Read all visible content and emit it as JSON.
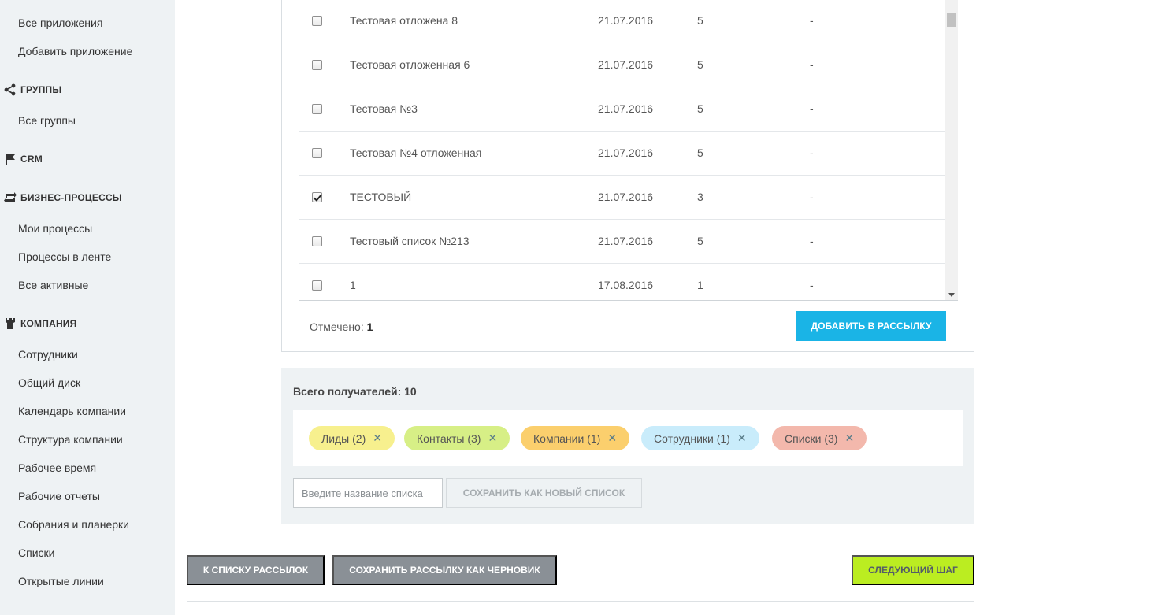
{
  "sidebar": {
    "links_top": [
      {
        "label": "Все приложения"
      },
      {
        "label": "Добавить приложение"
      }
    ],
    "sections": {
      "groups": {
        "title": "ГРУППЫ",
        "items": [
          "Все группы"
        ]
      },
      "crm": {
        "title": "CRM"
      },
      "bp": {
        "title": "БИЗНЕС-ПРОЦЕССЫ",
        "items": [
          "Мои процессы",
          "Процессы в ленте",
          "Все активные"
        ]
      },
      "company": {
        "title": "КОМПАНИЯ",
        "items": [
          "Сотрудники",
          "Общий диск",
          "Календарь компании",
          "Структура компании",
          "Рабочее время",
          "Рабочие отчеты",
          "Собрания и планерки",
          "Списки",
          "Открытые линии"
        ]
      }
    }
  },
  "table": {
    "rows": [
      {
        "name": "Тестовая отложена 8",
        "date": "21.07.2016",
        "count": "5",
        "extra": "-",
        "checked": false
      },
      {
        "name": "Тестовая отложенная 6",
        "date": "21.07.2016",
        "count": "5",
        "extra": "-",
        "checked": false
      },
      {
        "name": "Тестовая №3",
        "date": "21.07.2016",
        "count": "5",
        "extra": "-",
        "checked": false
      },
      {
        "name": "Тестовая №4 отложенная",
        "date": "21.07.2016",
        "count": "5",
        "extra": "-",
        "checked": false
      },
      {
        "name": "ТЕСТОВЫЙ",
        "date": "21.07.2016",
        "count": "3",
        "extra": "-",
        "checked": true
      },
      {
        "name": "Тестовый список №213",
        "date": "21.07.2016",
        "count": "5",
        "extra": "-",
        "checked": false
      },
      {
        "name": "1",
        "date": "17.08.2016",
        "count": "1",
        "extra": "-",
        "checked": false
      }
    ],
    "marked_label": "Отмечено:",
    "marked_count": "1",
    "add_button": "ДОБАВИТЬ В РАССЫЛКУ"
  },
  "recipients": {
    "title": "Всего получателей: 10",
    "tags": [
      {
        "label": "Лиды (2)",
        "color": "#f7f08e"
      },
      {
        "label": "Контакты (3)",
        "color": "#d7ef86"
      },
      {
        "label": "Компании (1)",
        "color": "#fbcf6d"
      },
      {
        "label": "Сотрудники (1)",
        "color": "#c9ecfb"
      },
      {
        "label": "Списки (3)",
        "color": "#f3b8ac"
      }
    ],
    "remove_glyph": "✕",
    "list_name_placeholder": "Введите название списка",
    "save_list_button": "СОХРАНИТЬ КАК НОВЫЙ СПИСОК"
  },
  "actions": {
    "back": "К СПИСКУ РАССЫЛОК",
    "save_draft": "СОХРАНИТЬ РАССЫЛКУ КАК ЧЕРНОВИК",
    "next": "СЛЕДУЮЩИЙ ШАГ"
  },
  "colors": {
    "accent_blue": "#1ab4e6",
    "accent_green": "#bbed21",
    "gray_button": "#8a9096",
    "sidebar_bg": "#eef2f4"
  }
}
